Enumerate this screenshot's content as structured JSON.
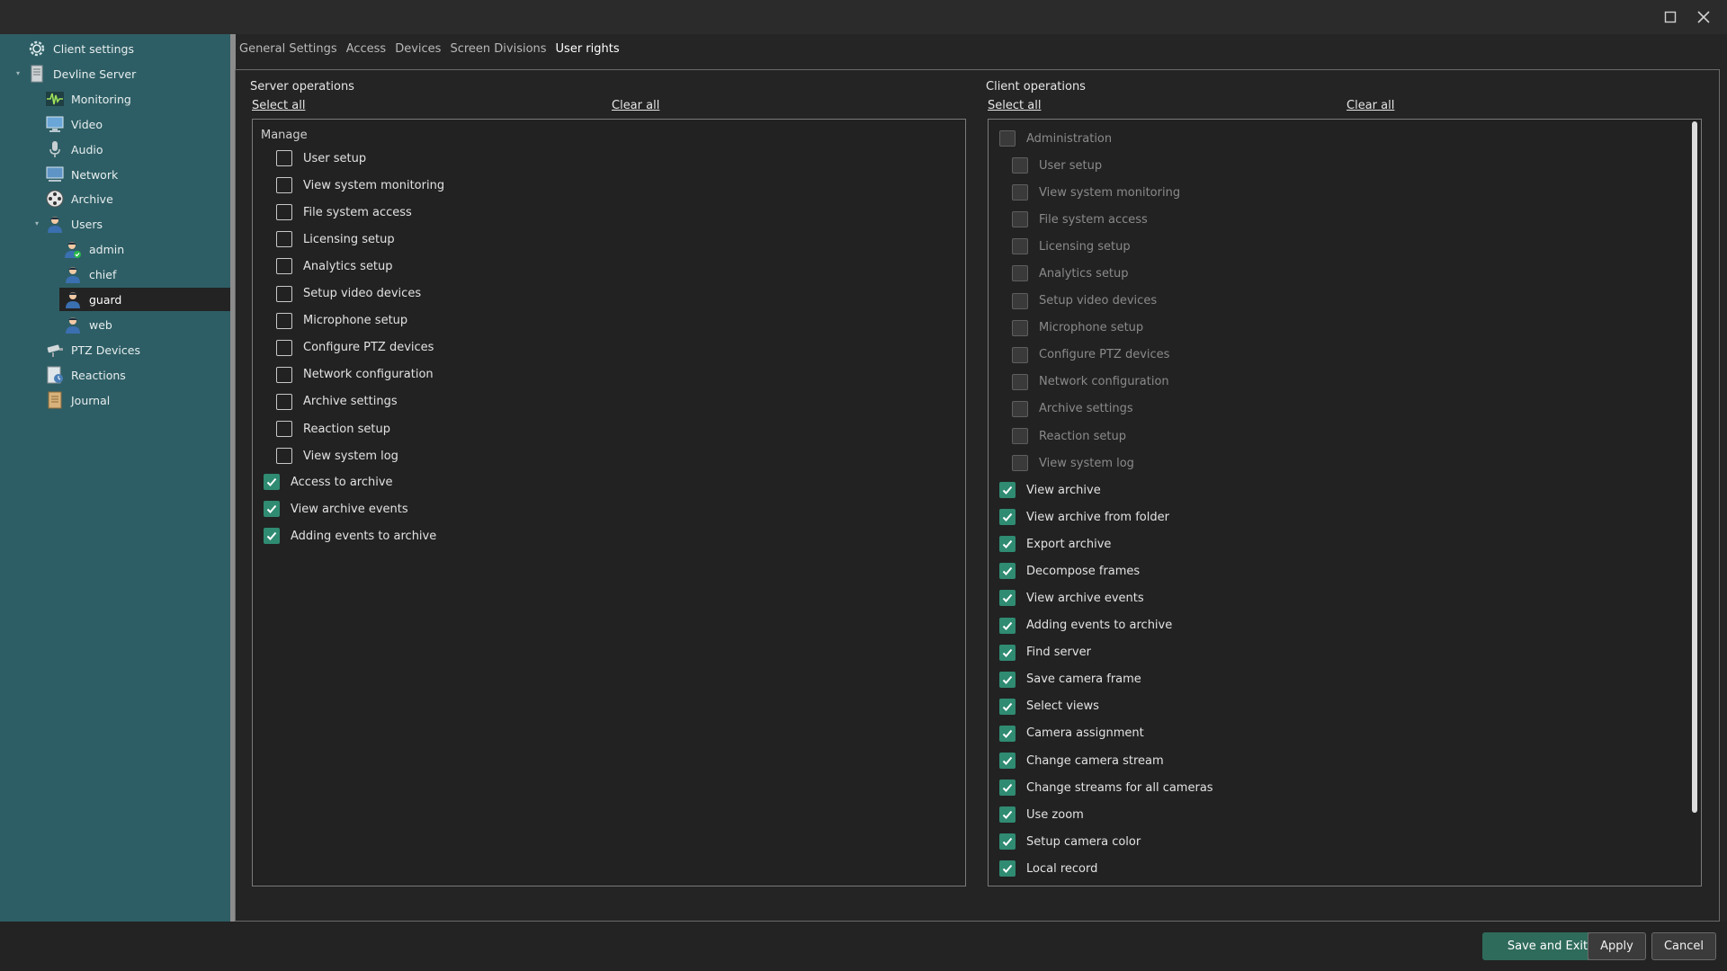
{
  "window": {
    "icons": {
      "maximize": "maximize-icon",
      "close": "close-icon"
    }
  },
  "sidebar": {
    "items": [
      {
        "label": "Client settings",
        "icon": "gear-icon"
      },
      {
        "label": "Devline Server",
        "icon": "server-icon"
      },
      {
        "label": "Monitoring",
        "icon": "waveform-icon"
      },
      {
        "label": "Video",
        "icon": "monitor-icon"
      },
      {
        "label": "Audio",
        "icon": "microphone-icon"
      },
      {
        "label": "Network",
        "icon": "network-icon"
      },
      {
        "label": "Archive",
        "icon": "film-reel-icon"
      },
      {
        "label": "Users",
        "icon": "users-icon"
      },
      {
        "label": "admin",
        "icon": "user-admin-icon"
      },
      {
        "label": "chief",
        "icon": "user-icon"
      },
      {
        "label": "guard",
        "icon": "user-icon"
      },
      {
        "label": "web",
        "icon": "user-icon"
      },
      {
        "label": "PTZ Devices",
        "icon": "ptz-camera-icon"
      },
      {
        "label": "Reactions",
        "icon": "reactions-icon"
      },
      {
        "label": "Journal",
        "icon": "journal-icon"
      }
    ],
    "selected": "guard"
  },
  "tabs": [
    {
      "label": "General Settings"
    },
    {
      "label": "Access"
    },
    {
      "label": "Devices"
    },
    {
      "label": "Screen Divisions"
    },
    {
      "label": "User rights"
    }
  ],
  "active_tab": "User rights",
  "server": {
    "title": "Server operations",
    "select_all": "Select all",
    "clear_all": "Clear all",
    "group_label": "Manage",
    "manage_items": [
      {
        "label": "User setup",
        "checked": false
      },
      {
        "label": "View system monitoring",
        "checked": false
      },
      {
        "label": "File system access",
        "checked": false
      },
      {
        "label": "Licensing setup",
        "checked": false
      },
      {
        "label": "Analytics setup",
        "checked": false
      },
      {
        "label": "Setup video devices",
        "checked": false
      },
      {
        "label": "Microphone setup",
        "checked": false
      },
      {
        "label": "Configure PTZ devices",
        "checked": false
      },
      {
        "label": "Network configuration",
        "checked": false
      },
      {
        "label": "Archive settings",
        "checked": false
      },
      {
        "label": "Reaction setup",
        "checked": false
      },
      {
        "label": "View system log",
        "checked": false
      }
    ],
    "other_items": [
      {
        "label": "Access to archive",
        "checked": true
      },
      {
        "label": "View archive events",
        "checked": true
      },
      {
        "label": "Adding events to archive",
        "checked": true
      }
    ]
  },
  "client": {
    "title": "Client operations",
    "select_all": "Select all",
    "clear_all": "Clear all",
    "admin_label": "Administration",
    "admin_items": [
      {
        "label": "User setup"
      },
      {
        "label": "View system monitoring"
      },
      {
        "label": "File system access"
      },
      {
        "label": "Licensing setup"
      },
      {
        "label": "Analytics setup"
      },
      {
        "label": "Setup video devices"
      },
      {
        "label": "Microphone setup"
      },
      {
        "label": "Configure PTZ devices"
      },
      {
        "label": "Network configuration"
      },
      {
        "label": "Archive settings"
      },
      {
        "label": "Reaction setup"
      },
      {
        "label": "View system log"
      }
    ],
    "items": [
      {
        "label": "View archive",
        "checked": true
      },
      {
        "label": "View archive from folder",
        "checked": true
      },
      {
        "label": "Export archive",
        "checked": true
      },
      {
        "label": "Decompose frames",
        "checked": true
      },
      {
        "label": "View archive events",
        "checked": true
      },
      {
        "label": "Adding events to archive",
        "checked": true
      },
      {
        "label": "Find server",
        "checked": true
      },
      {
        "label": "Save camera frame",
        "checked": true
      },
      {
        "label": "Select views",
        "checked": true
      },
      {
        "label": "Camera assignment",
        "checked": true
      },
      {
        "label": "Change camera stream",
        "checked": true
      },
      {
        "label": "Change streams for all cameras",
        "checked": true
      },
      {
        "label": "Use zoom",
        "checked": true
      },
      {
        "label": "Setup camera color",
        "checked": true
      },
      {
        "label": "Local record",
        "checked": true
      }
    ]
  },
  "footer": {
    "save_exit": "Save and Exit",
    "apply": "Apply",
    "cancel": "Cancel"
  },
  "colors": {
    "sidebar": "#2e5e65",
    "accent": "#2f8b72",
    "primary_button": "#2f6b5b"
  }
}
